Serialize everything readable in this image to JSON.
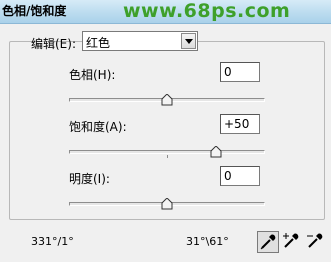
{
  "window": {
    "title": "色相/饱和度",
    "watermark": "www.68ps.com"
  },
  "edit": {
    "label": "编辑(E):",
    "selected": "红色"
  },
  "hue": {
    "label": "色相(H):",
    "value": "0",
    "slider_fraction": 0.5
  },
  "saturation": {
    "label": "饱和度(A):",
    "value": "+50",
    "slider_fraction": 0.75
  },
  "lightness": {
    "label": "明度(I):",
    "value": "0",
    "slider_fraction": 0.5
  },
  "range": {
    "left": "331°/1°",
    "right": "31°\\61°"
  },
  "tools": [
    "eyedropper-icon",
    "eyedropper-plus-icon",
    "eyedropper-minus-icon"
  ]
}
